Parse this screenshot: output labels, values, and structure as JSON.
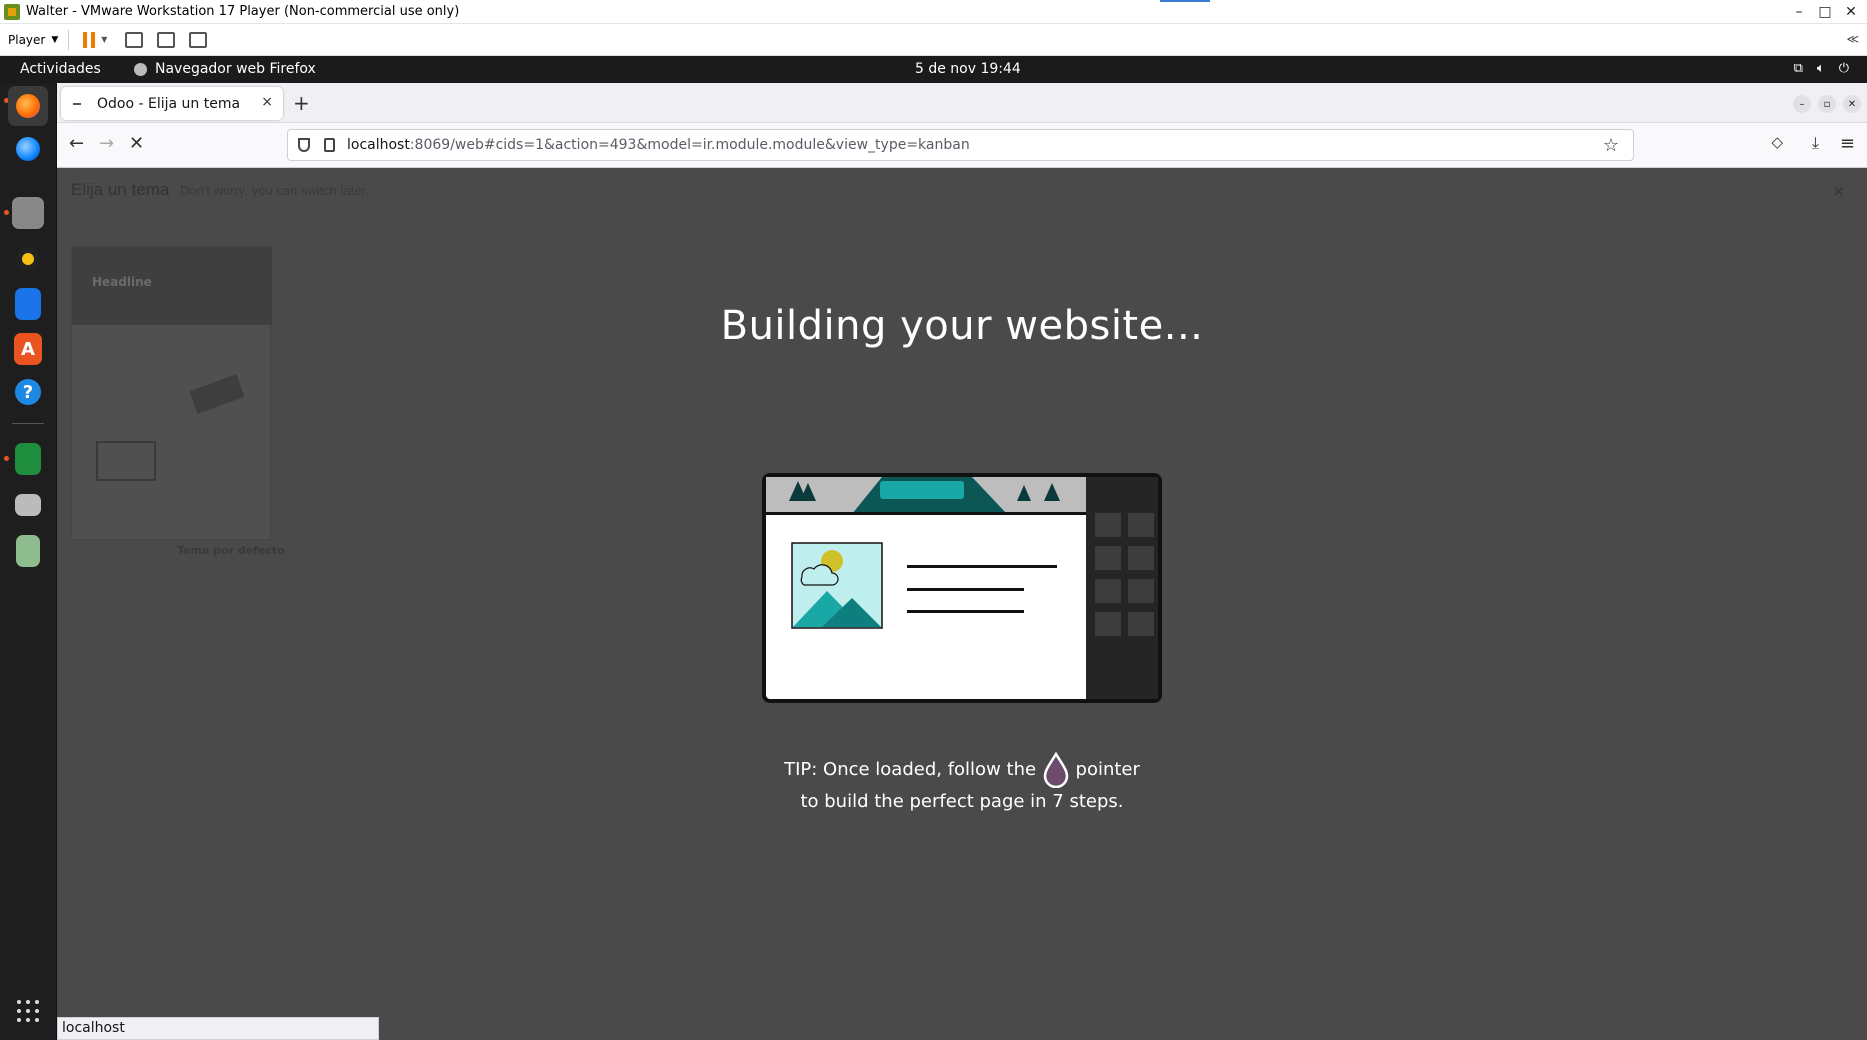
{
  "vm": {
    "title": "Walter - VMware Workstation 17 Player (Non-commercial use only)",
    "player_label": "Player",
    "min": "–",
    "max": "□",
    "close": "✕",
    "collapse": "≪"
  },
  "gnome": {
    "activities": "Actividades",
    "app_name": "Navegador web Firefox",
    "clock": "5 de nov  19:44"
  },
  "dock": {
    "apps": [
      "firefox-icon",
      "thunderbird-icon",
      "files-icon",
      "rhythmbox-icon",
      "writer-icon",
      "software-icon",
      "help-icon",
      "calc-icon",
      "drive-icon",
      "trash-icon"
    ]
  },
  "browser": {
    "tab_title": "Odoo - Elija un tema",
    "tab_close": "×",
    "new_tab": "+",
    "url_host": "localhost",
    "url_rest": ":8069/web#cids=1&action=493&model=ir.module.module&view_type=kanban",
    "status_text": "localhost"
  },
  "page": {
    "bg_title": "Elija un tema",
    "bg_subtitle": "Don't worry, you can switch later.",
    "bg_card_headline": "Headline",
    "bg_card_caption": "Tema por defecto",
    "bg_close": "×",
    "loader_title": "Building your website...",
    "tip_before": "TIP: Once loaded, follow the",
    "tip_after": "pointer to build the perfect page in 7 steps."
  },
  "colors": {
    "overlay": "#4a4a4a",
    "teal": "#1aa8a7",
    "drop": "#6e4a6d"
  }
}
